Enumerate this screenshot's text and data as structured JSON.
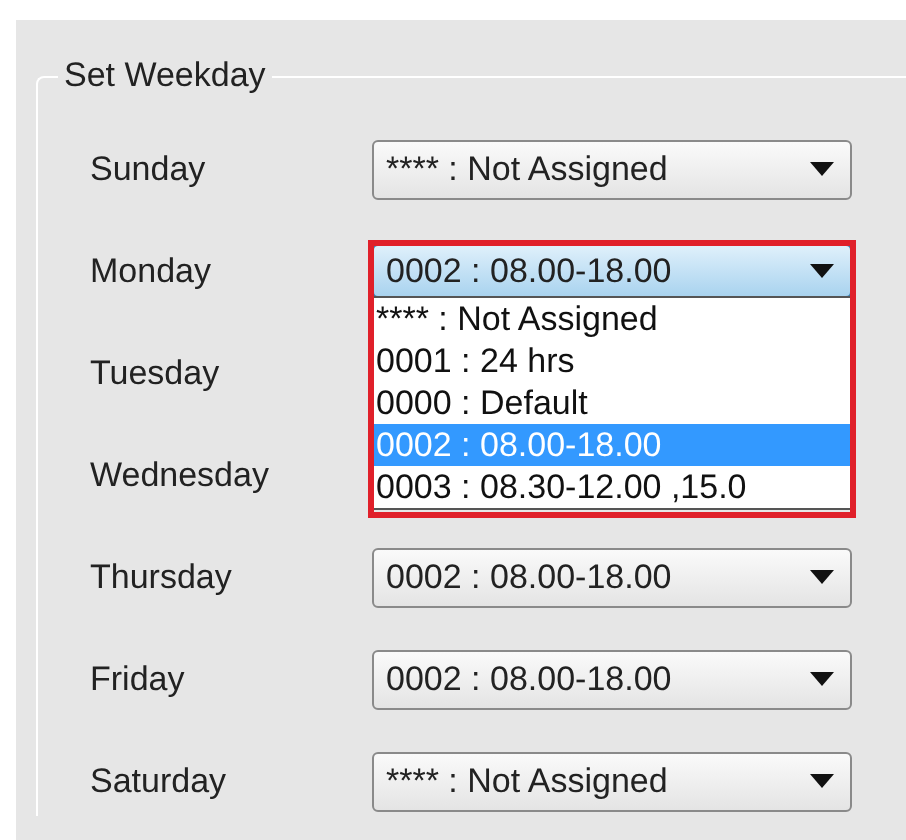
{
  "group": {
    "title": "Set Weekday"
  },
  "days": [
    {
      "label": "Sunday",
      "value": "**** : Not Assigned",
      "open": false,
      "highlighted": false
    },
    {
      "label": "Monday",
      "value": "0002 : 08.00-18.00",
      "open": true,
      "highlighted": true,
      "options": [
        {
          "label": "**** : Not Assigned",
          "selected": false
        },
        {
          "label": "0001 : 24 hrs",
          "selected": false
        },
        {
          "label": "0000 : Default",
          "selected": false
        },
        {
          "label": "0002 : 08.00-18.00",
          "selected": true
        },
        {
          "label": "0003 : 08.30-12.00 ,15.0",
          "selected": false
        }
      ]
    },
    {
      "label": "Tuesday"
    },
    {
      "label": "Wednesday"
    },
    {
      "label": "Thursday",
      "value": "0002 : 08.00-18.00",
      "open": false,
      "highlighted": false
    },
    {
      "label": "Friday",
      "value": "0002 : 08.00-18.00",
      "open": false,
      "highlighted": false
    },
    {
      "label": "Saturday",
      "value": "**** : Not Assigned",
      "open": false,
      "highlighted": false
    }
  ]
}
